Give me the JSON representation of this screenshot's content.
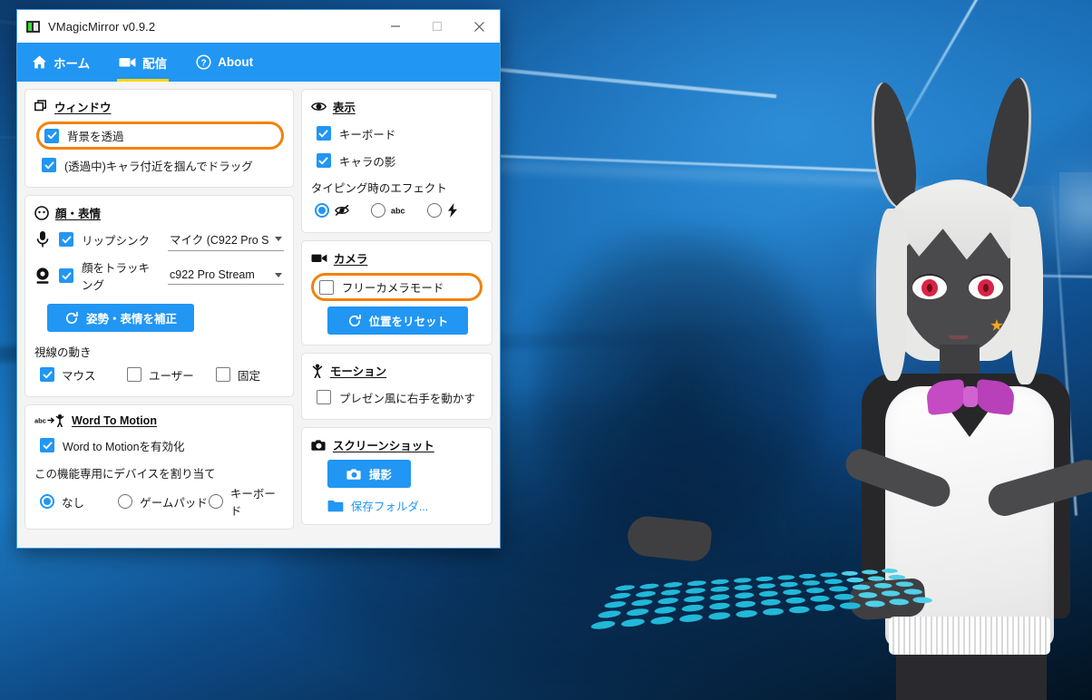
{
  "window": {
    "title": "VMagicMirror v0.9.2",
    "app_icon": "app-icon",
    "controls": {
      "minimize": "minimize",
      "maximize": "maximize",
      "close": "close"
    }
  },
  "tabs": [
    {
      "label": "ホーム",
      "icon": "home-icon",
      "active": false
    },
    {
      "label": "配信",
      "icon": "video-camera-icon",
      "active": true
    },
    {
      "label": "About",
      "icon": "question-circle-icon",
      "active": false
    }
  ],
  "left_column": {
    "window_section": {
      "title": "ウィンドウ",
      "icon": "windows-copy-icon",
      "items": [
        {
          "label": "背景を透過",
          "checked": true,
          "highlighted": true
        },
        {
          "label": "(透過中)キャラ付近を掴んでドラッグ",
          "checked": true,
          "highlighted": false
        }
      ]
    },
    "face_section": {
      "title": "顔・表情",
      "icon": "face-icon",
      "lipsync": {
        "label": "リップシンク",
        "checked": true,
        "icon": "microphone-icon",
        "device": "マイク (C922 Pro S"
      },
      "facetrack": {
        "label": "顔をトラッキング",
        "checked": true,
        "icon": "webcam-icon",
        "device": "c922 Pro Stream"
      },
      "calibrate_button": {
        "label": "姿勢・表情を補正",
        "icon": "refresh-icon"
      },
      "gaze_label": "視線の動き",
      "gaze_options": [
        {
          "label": "マウス",
          "checked": true
        },
        {
          "label": "ユーザー",
          "checked": false
        },
        {
          "label": "固定",
          "checked": false
        }
      ]
    },
    "wtm_section": {
      "title": "Word To Motion",
      "icon": "abc-to-person-icon",
      "enable": {
        "label": "Word to Motionを有効化",
        "checked": true
      },
      "device_label": "この機能専用にデバイスを割り当て",
      "device_options": [
        {
          "label": "なし",
          "selected": true
        },
        {
          "label": "ゲームパッド",
          "selected": false
        },
        {
          "label": "キーボード",
          "selected": false
        }
      ]
    }
  },
  "right_column": {
    "display_section": {
      "title": "表示",
      "icon": "eye-icon",
      "items": [
        {
          "label": "キーボード",
          "checked": true
        },
        {
          "label": "キャラの影",
          "checked": true
        }
      ],
      "effect_label": "タイピング時のエフェクト",
      "effect_options": [
        {
          "icon": "eye-off-icon",
          "selected": true
        },
        {
          "icon": "abc-icon",
          "label": "abc",
          "selected": false
        },
        {
          "icon": "lightning-icon",
          "selected": false
        }
      ]
    },
    "camera_section": {
      "title": "カメラ",
      "icon": "video-camera-icon",
      "free_camera": {
        "label": "フリーカメラモード",
        "checked": false,
        "highlighted": true
      },
      "reset_button": {
        "label": "位置をリセット",
        "icon": "refresh-icon"
      }
    },
    "motion_section": {
      "title": "モーション",
      "icon": "person-icon",
      "items": [
        {
          "label": "プレゼン風に右手を動かす",
          "checked": false
        }
      ]
    },
    "screenshot_section": {
      "title": "スクリーンショット",
      "icon": "camera-icon",
      "capture_button": {
        "label": "撮影",
        "icon": "camera-icon"
      },
      "folder_link": {
        "label": "保存フォルダ...",
        "icon": "folder-icon"
      }
    }
  },
  "colors": {
    "accent": "#2196f3",
    "highlight": "#f2820a",
    "tab_underline": "#ffd600",
    "window_border": "#4a9fe0"
  },
  "desktop": {
    "wallpaper": "windows-10-hero-wallpaper",
    "avatar": "vrm-avatar-character",
    "keyboard_effect": "virtual-keyboard-cyan"
  }
}
